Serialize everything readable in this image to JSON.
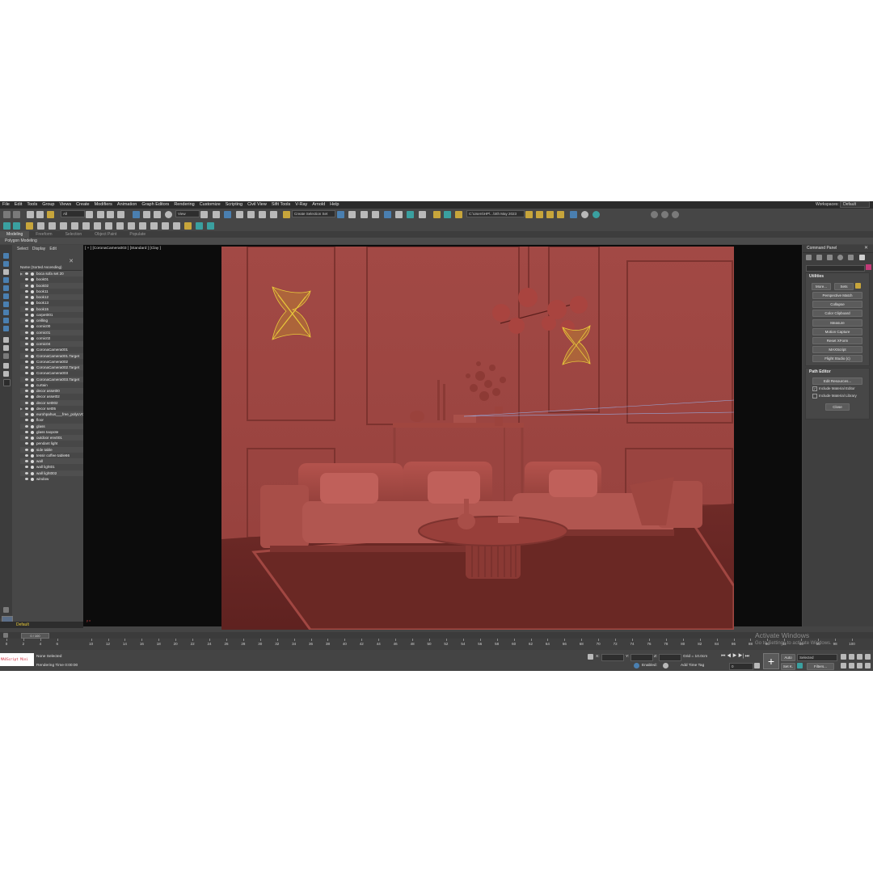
{
  "menu": [
    "File",
    "Edit",
    "Tools",
    "Group",
    "Views",
    "Create",
    "Modifiers",
    "Animation",
    "Graph Editors",
    "Rendering",
    "Customize",
    "Scripting",
    "Civil View",
    "Sifit Tools",
    "V-Ray",
    "Arnold",
    "Help"
  ],
  "workspace": {
    "label": "Workspaces:",
    "value": "Default"
  },
  "toolbar": {
    "filter": "All",
    "view": "View",
    "selection_set": "Create Selection Set",
    "project_path": "C:\\Users\\HP\\...\\Sth May 2023"
  },
  "ribbon": {
    "tabs": [
      "Modeling",
      "Freeform",
      "Selection",
      "Object Paint",
      "Populate"
    ],
    "active_tab": "Modeling",
    "subtitle": "Polygon Modeling"
  },
  "explorer": {
    "tabs": [
      "Select",
      "Display",
      "Edit"
    ],
    "close": "✕",
    "column_header": "Name (Sorted Ascending)",
    "items": [
      {
        "name": "boca sofa set 20",
        "expand": true
      },
      {
        "name": "book01"
      },
      {
        "name": "book02"
      },
      {
        "name": "book11"
      },
      {
        "name": "book12"
      },
      {
        "name": "book13"
      },
      {
        "name": "book15"
      },
      {
        "name": "carpet001"
      },
      {
        "name": "ceilling"
      },
      {
        "name": "cornic00"
      },
      {
        "name": "cornic01"
      },
      {
        "name": "cornic02"
      },
      {
        "name": "cornic04"
      },
      {
        "name": "CoronaCamera001"
      },
      {
        "name": "CoronaCamera001.Target"
      },
      {
        "name": "CoronaCamera002"
      },
      {
        "name": "CoronaCamera002.Target"
      },
      {
        "name": "CoronaCamera003"
      },
      {
        "name": "CoronaCamera003.Target"
      },
      {
        "name": "curtain"
      },
      {
        "name": "decor asset00"
      },
      {
        "name": "decor asset02"
      },
      {
        "name": "decor set002"
      },
      {
        "name": "decor set05",
        "expand": true
      },
      {
        "name": "eurohpahus___free_polyLVG"
      },
      {
        "name": "floor"
      },
      {
        "name": "glass"
      },
      {
        "name": "glass taopote"
      },
      {
        "name": "outdoor env001"
      },
      {
        "name": "pendant light"
      },
      {
        "name": "side table"
      },
      {
        "name": "tessir coffee table66"
      },
      {
        "name": "wall"
      },
      {
        "name": "wall light01"
      },
      {
        "name": "wall light002"
      },
      {
        "name": "window"
      }
    ],
    "layer": "Default"
  },
  "viewport": {
    "label": "[ + ] [CoronaCamera003 ] [Standard ] [Clay ]",
    "axes": "y  x"
  },
  "command_panel": {
    "title": "Command Panel",
    "close": "✕",
    "utilities": {
      "title": "Utilities",
      "more": "More...",
      "sets": "Sets",
      "buttons": [
        "Perspective Match",
        "Collapse",
        "Color Clipboard",
        "Measure",
        "Motion Capture",
        "Reset XForm",
        "MAXScript",
        "Flight Studio (c)"
      ]
    },
    "path_editor": {
      "title": "Path Editor",
      "edit_resources": "Edit Resources...",
      "include_material_editor": "Include Material Editor",
      "include_material_library": "Include Material Library",
      "close": "Close"
    }
  },
  "timeline": {
    "slider": "0 / 100",
    "ticks": [
      "0",
      "2",
      "4",
      "6",
      "10",
      "12",
      "14",
      "16",
      "18",
      "20",
      "22",
      "24",
      "26",
      "28",
      "30",
      "32",
      "34",
      "36",
      "38",
      "40",
      "42",
      "44",
      "46",
      "48",
      "50",
      "52",
      "54",
      "56",
      "58",
      "60",
      "62",
      "64",
      "66",
      "68",
      "70",
      "72",
      "74",
      "76",
      "78",
      "80",
      "82",
      "84",
      "86",
      "88",
      "90",
      "92",
      "94",
      "96",
      "98",
      "100"
    ]
  },
  "status": {
    "maxscript": "MAXScript Mini",
    "selection": "None Selected",
    "render_time": "Rendering Time  0:00:00",
    "x_label": "X:",
    "y_label": "Y:",
    "z_label": "Z:",
    "grid": "Grid = 10.0cm",
    "enabled": "Enabled:",
    "add_time_tag": "Add Time Tag",
    "auto": "Auto",
    "selected": "Selected",
    "set_k": "Set K.",
    "filters": "Filters...",
    "frame": "0"
  },
  "watermark": {
    "title": "Activate Windows",
    "subtitle": "Go to Settings to activate Windows."
  },
  "colors": {
    "clay": "#a84e48",
    "clay_dark": "#7a2f2b",
    "gold": "#e8c93a",
    "ui_bg": "#444444"
  }
}
